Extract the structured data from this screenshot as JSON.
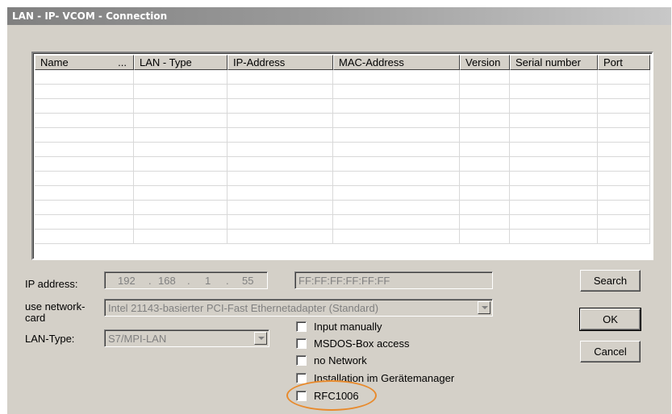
{
  "window": {
    "title": "LAN - IP- VCOM - Connection"
  },
  "table": {
    "columns": [
      {
        "label": "Name",
        "extra": "...",
        "width": 123
      },
      {
        "label": "LAN - Type",
        "width": 116
      },
      {
        "label": "IP-Address",
        "width": 131
      },
      {
        "label": "MAC-Address",
        "width": 157
      },
      {
        "label": "Version",
        "width": 62
      },
      {
        "label": "Serial number",
        "width": 109
      },
      {
        "label": "Port",
        "width": 65
      }
    ],
    "row_count": 12
  },
  "ip_address": {
    "label": "IP address:",
    "octets": [
      "192",
      "168",
      "1",
      "55"
    ]
  },
  "mac_address": {
    "value": "FF:FF:FF:FF:FF:FF"
  },
  "network_card": {
    "label_line1": "use network-",
    "label_line2": "card",
    "value": "Intel 21143-basierter PCI-Fast Ethernetadapter (Standard)"
  },
  "lan_type": {
    "label": "LAN-Type:",
    "value": "S7/MPI-LAN"
  },
  "checkboxes": [
    {
      "label": "Input manually",
      "checked": false
    },
    {
      "label": "MSDOS-Box access",
      "checked": false
    },
    {
      "label": "no Network",
      "checked": false
    },
    {
      "label": "Installation im Gerätemanager",
      "checked": false
    },
    {
      "label": "RFC1006",
      "checked": false
    }
  ],
  "buttons": {
    "search": "Search",
    "ok": "OK",
    "cancel": "Cancel"
  },
  "colors": {
    "highlight": "#e88a2c",
    "dialog": "#d4d0c8"
  }
}
